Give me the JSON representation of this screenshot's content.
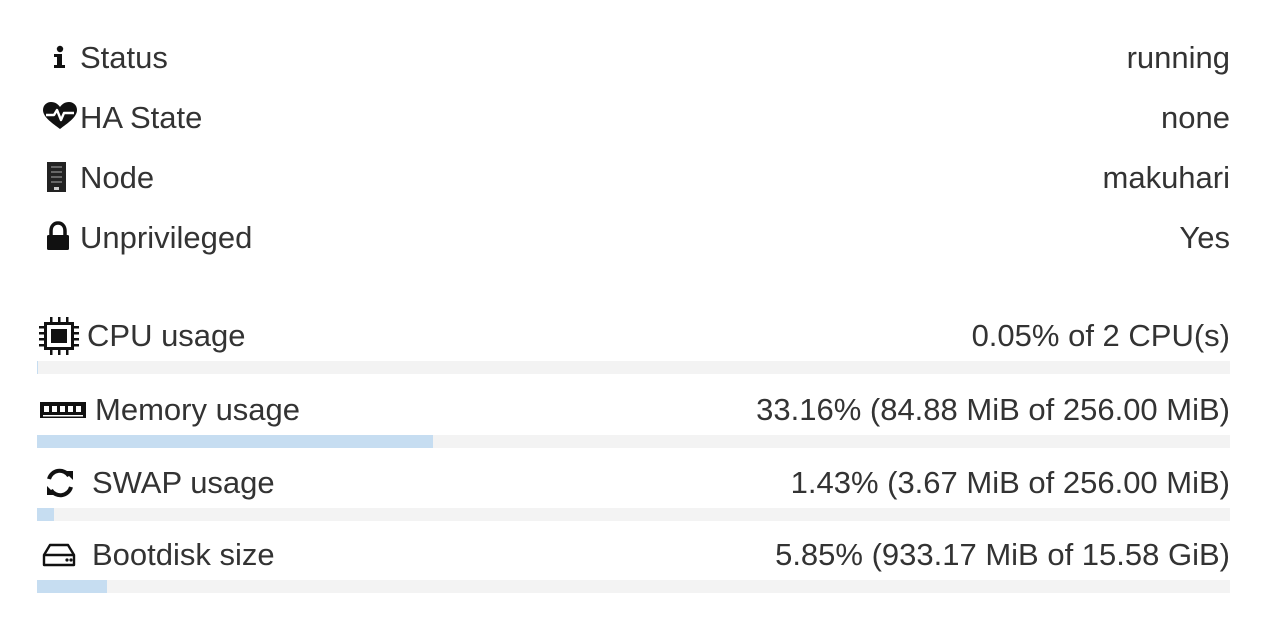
{
  "info": [
    {
      "name": "status",
      "icon": "info-icon",
      "label": "Status",
      "value": "running"
    },
    {
      "name": "ha-state",
      "icon": "heartbeat-icon",
      "label": "HA State",
      "value": "none"
    },
    {
      "name": "node",
      "icon": "server-icon",
      "label": "Node",
      "value": "makuhari"
    },
    {
      "name": "unprivileged",
      "icon": "lock-icon",
      "label": "Unprivileged",
      "value": "Yes"
    }
  ],
  "usage": [
    {
      "name": "cpu",
      "icon": "cpu-chip-icon",
      "label": "CPU usage",
      "value": "0.05% of 2 CPU(s)",
      "fraction": 0.0005
    },
    {
      "name": "memory",
      "icon": "memory-icon",
      "label": "Memory usage",
      "value": "33.16% (84.88 MiB of 256.00 MiB)",
      "fraction": 0.3316
    },
    {
      "name": "swap",
      "icon": "refresh-icon",
      "label": "SWAP usage",
      "value": "1.43% (3.67 MiB of 256.00 MiB)",
      "fraction": 0.0143
    },
    {
      "name": "bootdisk",
      "icon": "hdd-icon",
      "label": "Bootdisk size",
      "value": "5.85% (933.17 MiB of 15.58 GiB)",
      "fraction": 0.0585
    }
  ],
  "colors": {
    "bar_fill": "#c6ddf1",
    "bar_track": "#f3f3f3",
    "text": "#333333"
  }
}
